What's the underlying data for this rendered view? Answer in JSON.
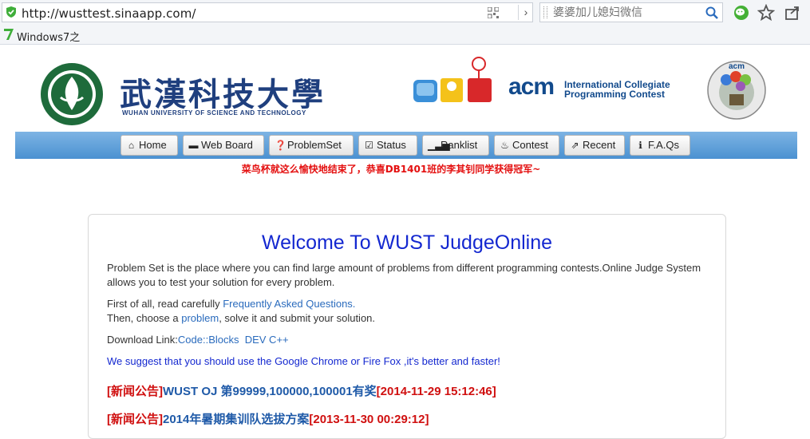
{
  "browser": {
    "url": "http://wusttest.sinaapp.com/",
    "search_placeholder": "婆婆加儿媳妇微信",
    "favorite_label": "Windows7之"
  },
  "header": {
    "school_name_cn": "武漢科技大學",
    "school_name_en": "WUHAN UNIVERSITY OF SCIENCE AND TECHNOLOGY",
    "acm_word": "acm",
    "acm_line1": "International Collegiate",
    "acm_line2": "Programming Contest",
    "acm_logo_text": "acm"
  },
  "nav": {
    "items": [
      {
        "label": "Home",
        "icon": "home-icon"
      },
      {
        "label": "Web Board",
        "icon": "comment-icon"
      },
      {
        "label": "ProblemSet",
        "icon": "question-icon"
      },
      {
        "label": "Status",
        "icon": "checkbox-icon"
      },
      {
        "label": "Ranklist",
        "icon": "signal-icon"
      },
      {
        "label": "Contest",
        "icon": "fire-icon"
      },
      {
        "label": "Recent",
        "icon": "share-icon"
      },
      {
        "label": "F.A.Qs",
        "icon": "info-icon"
      }
    ]
  },
  "notice": "菜鸟杯就这么愉快地结束了，恭喜DB1401班的李其钊同学获得冠军~",
  "main": {
    "title": "Welcome To WUST JudgeOnline",
    "intro": "Problem Set is the place where you can find large amount of problems from different programming contests.Online Judge System allows you to test your solution for every problem.",
    "first_text": "First of all, read carefully ",
    "faq_link": "Frequently Asked Questions.",
    "then_text": "Then, choose a ",
    "problem_link": "problem",
    "then_rest": ", solve it and submit your solution.",
    "download_label": "Download Link:",
    "download_codeblocks": "Code::Blocks",
    "download_devcpp": "DEV C++",
    "suggest": "We suggest that you should use the Google Chrome or Fire Fox ,it's better and faster!",
    "news": [
      {
        "tag": "[新闻公告]",
        "title": "WUST OJ 第99999,100000,100001有奖",
        "date": "[2014-11-29 15:12:46]"
      },
      {
        "tag": "[新闻公告]",
        "title": "2014年暑期集训队选拔方案",
        "date": "[2013-11-30 00:29:12]"
      }
    ]
  }
}
